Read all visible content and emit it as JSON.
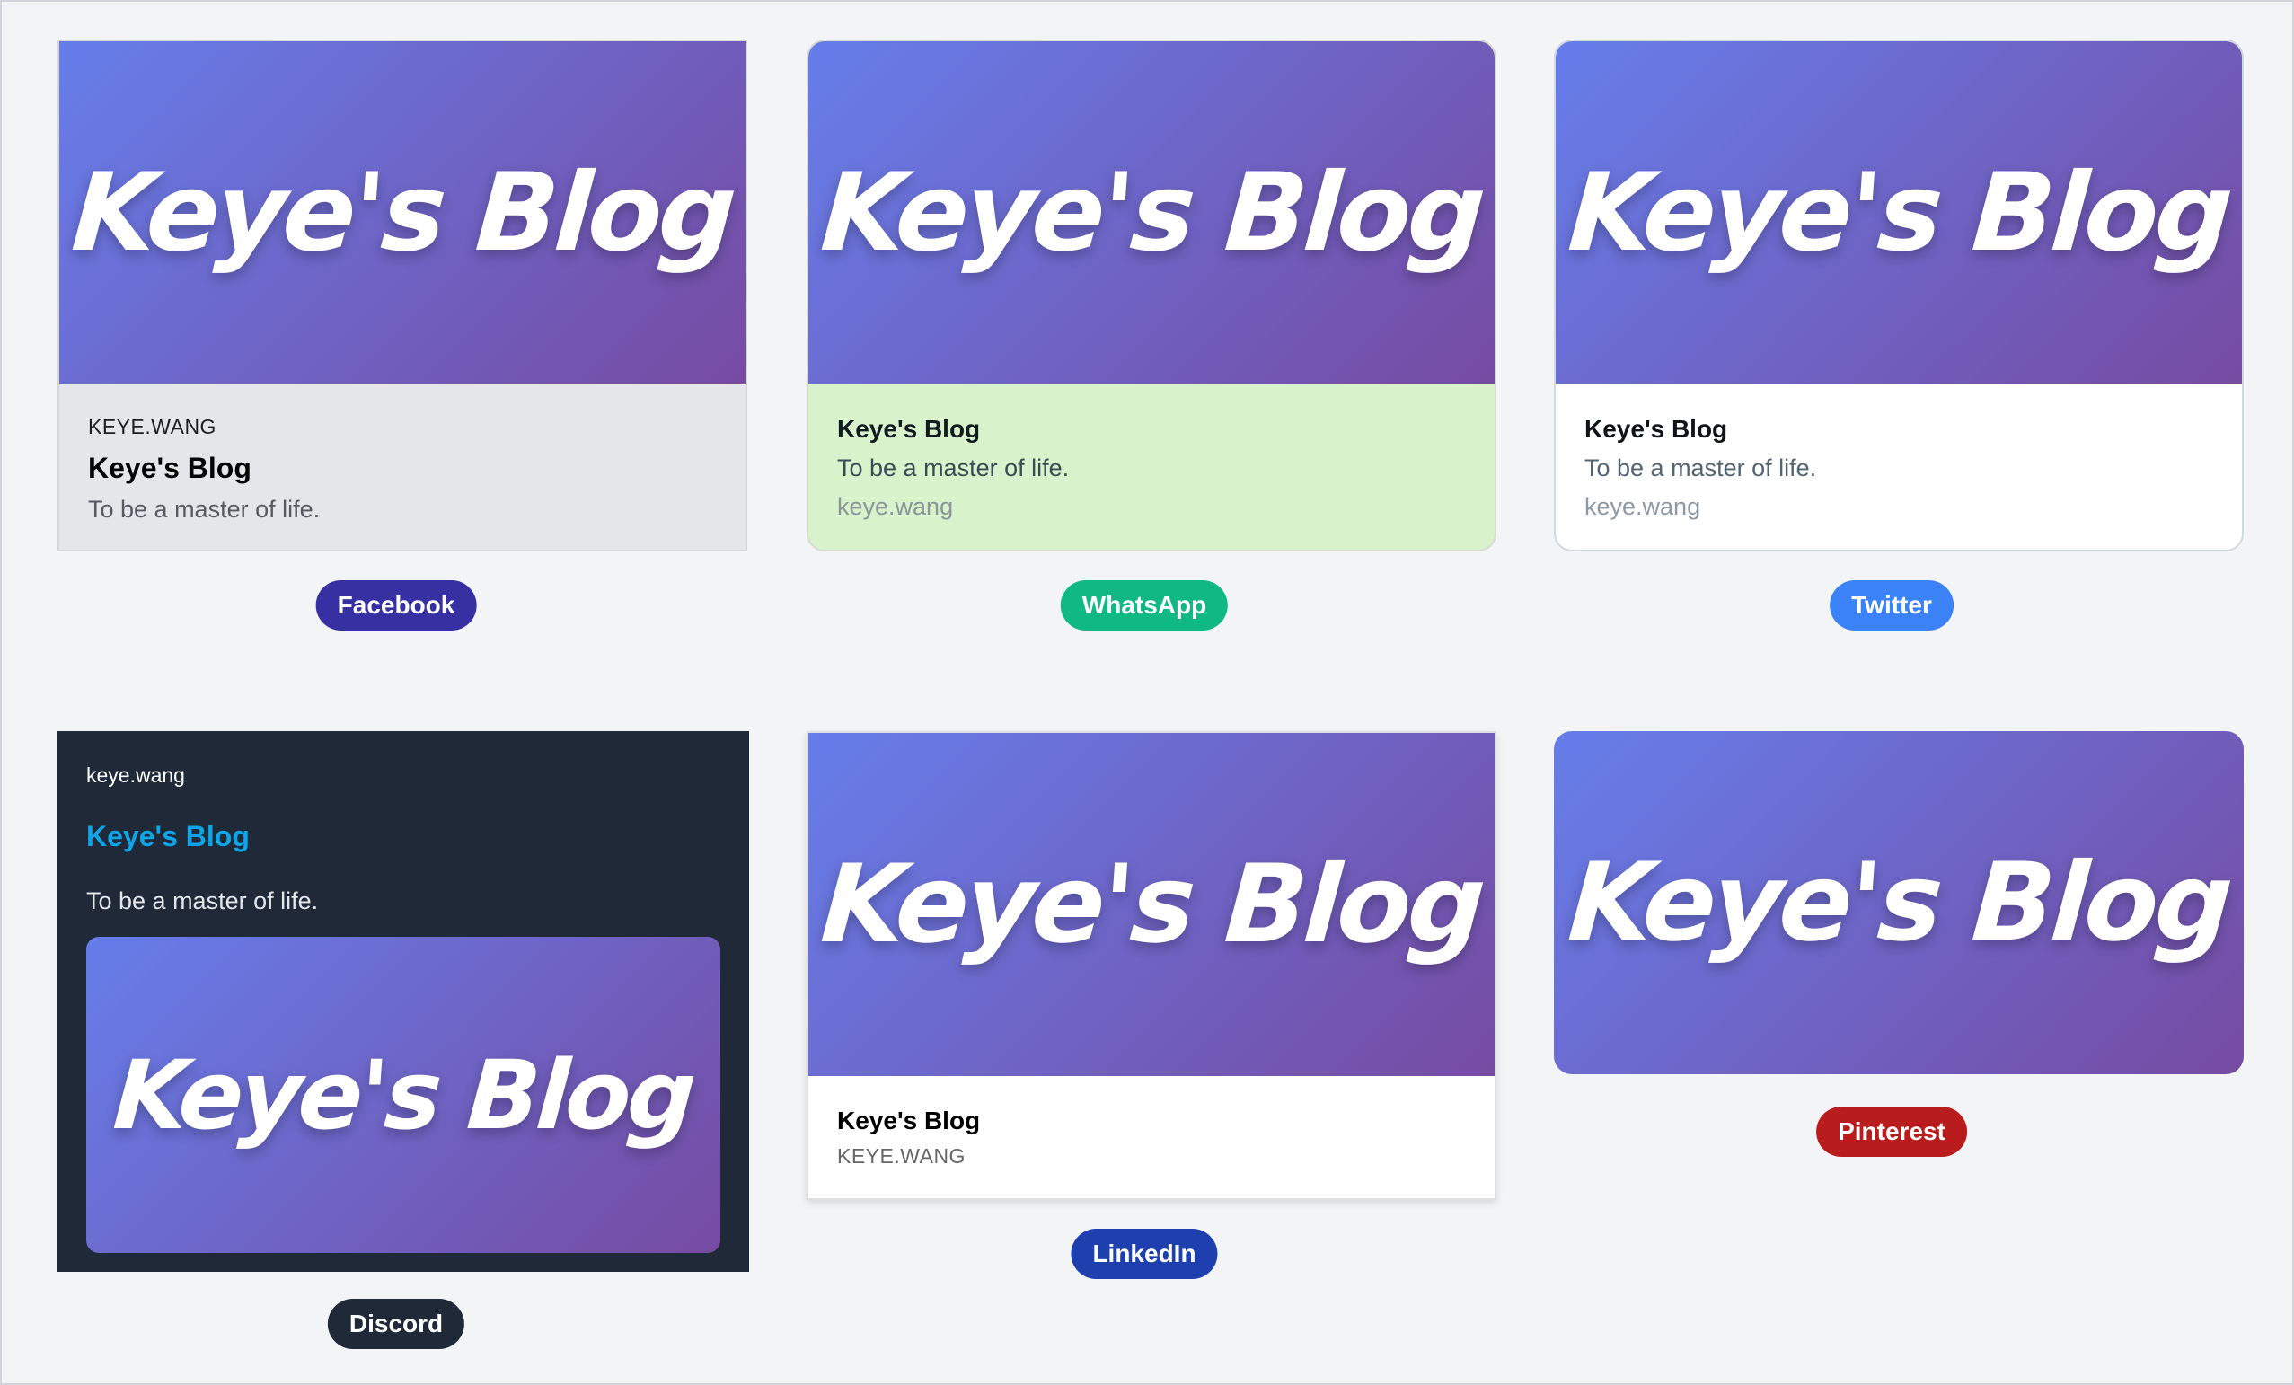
{
  "hero_text": "Keye's Blog",
  "facebook": {
    "domain": "KEYE.WANG",
    "title": "Keye's Blog",
    "description": "To be a master of life.",
    "badge": "Facebook",
    "badge_color": "#3730a3"
  },
  "whatsapp": {
    "title": "Keye's Blog",
    "description": "To be a master of life.",
    "url": "keye.wang",
    "badge": "WhatsApp",
    "badge_color": "#10b981"
  },
  "twitter": {
    "title": "Keye's Blog",
    "description": "To be a master of life.",
    "url": "keye.wang",
    "badge": "Twitter",
    "badge_color": "#3b82f6"
  },
  "discord": {
    "site": "keye.wang",
    "title": "Keye's Blog",
    "description": "To be a master of life.",
    "badge": "Discord",
    "badge_color": "#1f2937"
  },
  "linkedin": {
    "title": "Keye's Blog",
    "domain": "KEYE.WANG",
    "badge": "LinkedIn",
    "badge_color": "#1e40af"
  },
  "pinterest": {
    "badge": "Pinterest",
    "badge_color": "#b91c1c"
  }
}
